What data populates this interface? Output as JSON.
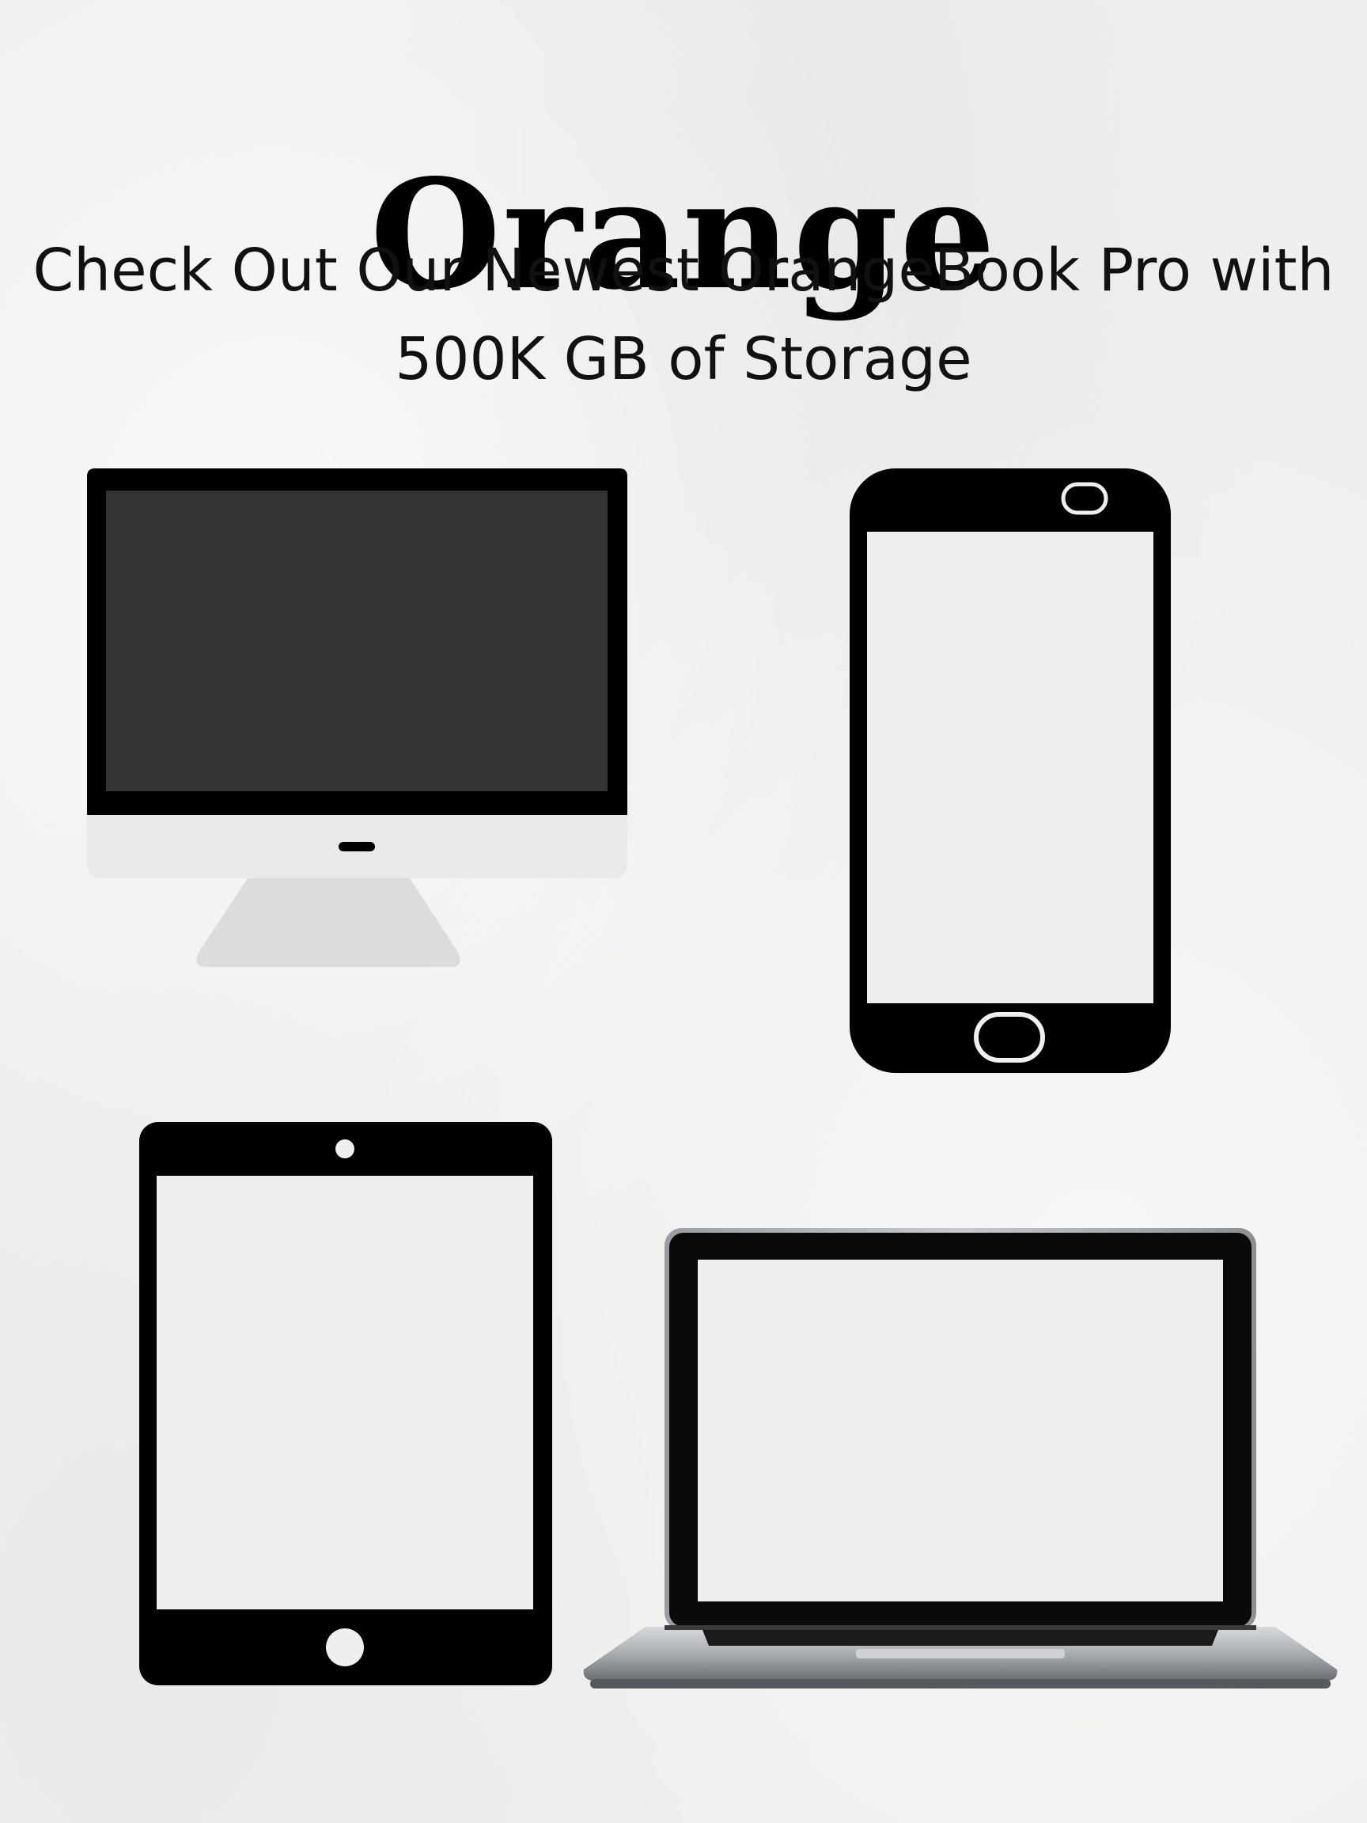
{
  "header": {
    "title": "Orange",
    "tagline_line1": "Check Out Our Newest OrangeBook Pro with",
    "tagline_line2": "500K GB of Storage"
  },
  "devices": [
    {
      "icon": "desktop-monitor-icon"
    },
    {
      "icon": "smartphone-icon"
    },
    {
      "icon": "tablet-icon"
    },
    {
      "icon": "laptop-icon"
    }
  ],
  "colors": {
    "background": "#efefee",
    "device_frame": "#000000",
    "monitor_screen": "#333333",
    "monitor_chin": "#e9e9ea",
    "laptop_body": "#b9bcbf"
  }
}
